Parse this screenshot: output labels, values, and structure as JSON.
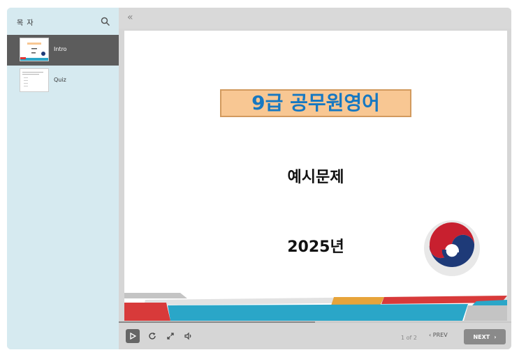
{
  "sidebar": {
    "title": "목 자",
    "search_icon": "search-icon",
    "items": [
      {
        "label": "Intro",
        "active": true
      },
      {
        "label": "Quiz",
        "active": false
      }
    ]
  },
  "topbar": {
    "collapse_glyph": "«"
  },
  "slide": {
    "title": "9급 공무원영어",
    "subtitle": "예시문제",
    "year": "2025년",
    "colors": {
      "title_text": "#1678c2",
      "title_box": "#f8c793"
    }
  },
  "controls": {
    "progress": 0.5,
    "counter": "1 of 2",
    "prev_label": "PREV",
    "next_label": "NEXT",
    "icons": [
      "play-icon",
      "replay-icon",
      "fullscreen-icon",
      "volume-icon"
    ]
  }
}
